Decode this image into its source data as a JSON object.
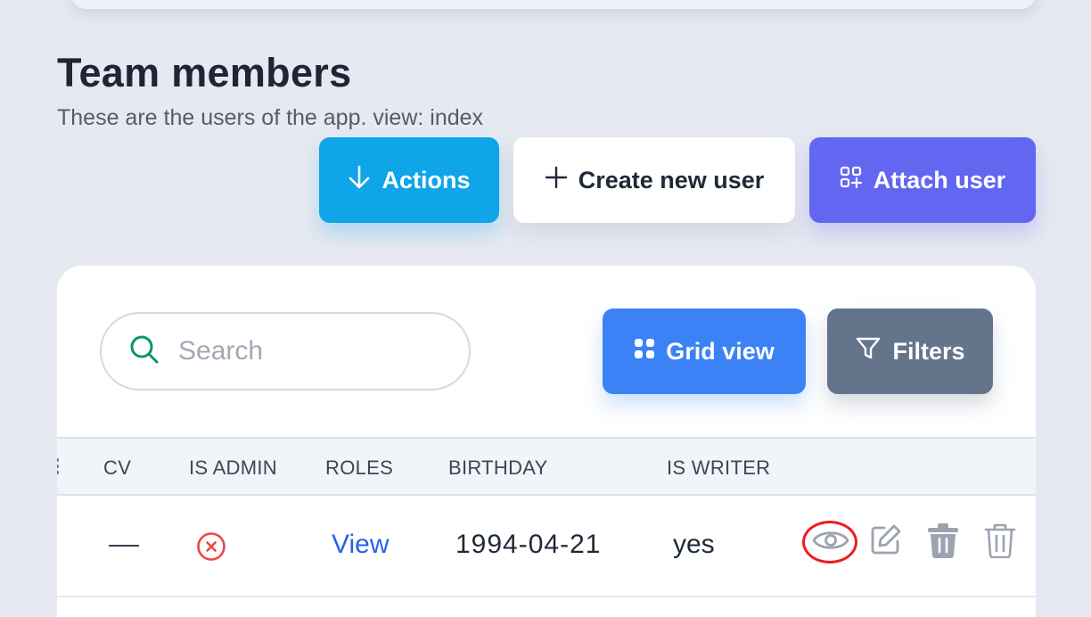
{
  "header": {
    "title": "Team members",
    "subtitle": "These are the users of the app. view: index"
  },
  "toolbar": {
    "actions_label": "Actions",
    "create_label": "Create new user",
    "attach_label": "Attach user"
  },
  "panel": {
    "search_placeholder": "Search",
    "grid_view_label": "Grid view",
    "filters_label": "Filters"
  },
  "table": {
    "columns": [
      "CV",
      "IS ADMIN",
      "ROLES",
      "BIRTHDAY",
      "IS WRITER"
    ],
    "rows": [
      {
        "roles_link": "View",
        "birthday": "1994-04-21",
        "is_writer": "yes"
      }
    ]
  },
  "colors": {
    "actions": "#0ea5e9",
    "attach": "#6366f1",
    "grid_view": "#3b82f6",
    "filters": "#64748b",
    "admin_false": "#ef4444",
    "highlight": "#ef1b1b"
  },
  "icons": {
    "actions": "arrow-down-icon",
    "create": "plus-icon",
    "attach": "apps-add-icon",
    "search": "search-icon",
    "grid": "grid-icon",
    "filters": "funnel-icon",
    "admin_false": "x-circle-icon",
    "row_actions": [
      "eye-icon",
      "edit-icon",
      "trash-filled-icon",
      "trash-outline-icon"
    ]
  }
}
